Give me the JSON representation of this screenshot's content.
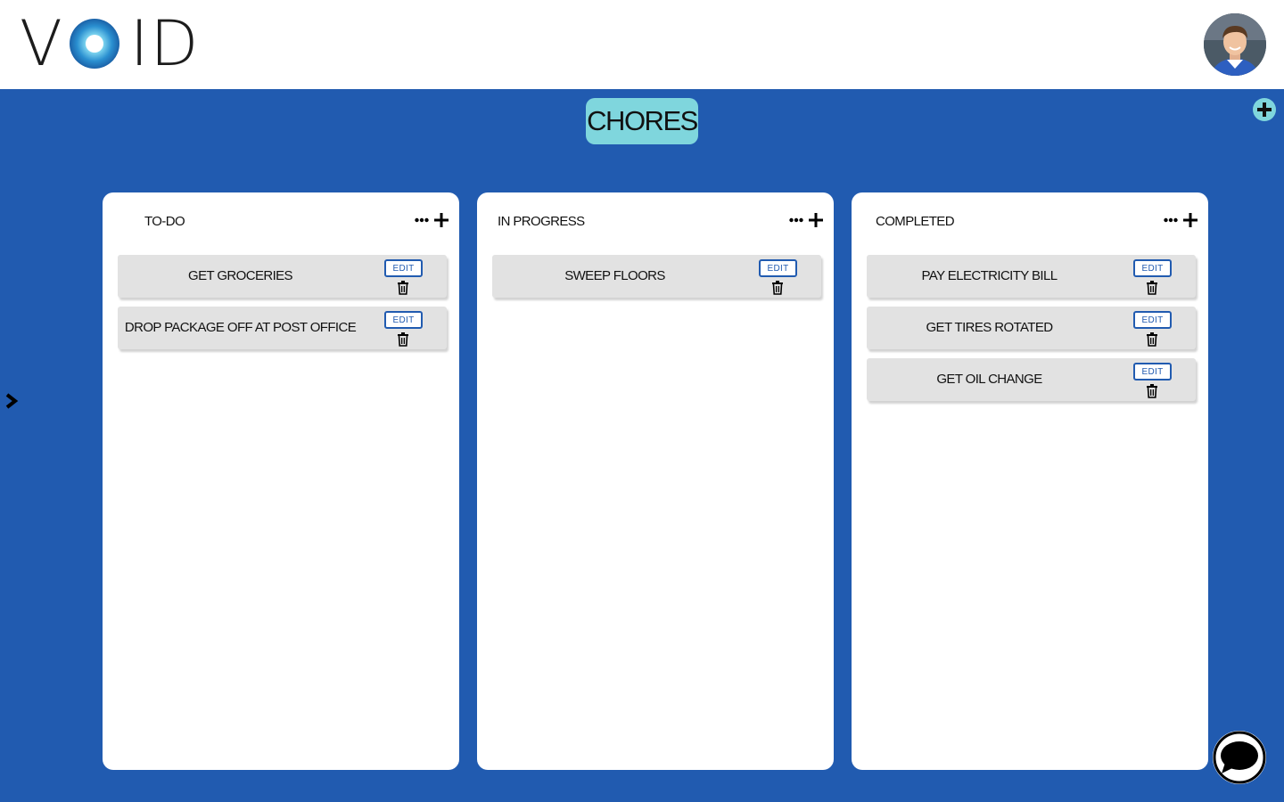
{
  "header": {
    "logo": {
      "letters": [
        "V",
        "I",
        "D"
      ],
      "o_icon": "void-ring-icon"
    },
    "avatar": {
      "icon": "user-avatar"
    }
  },
  "board": {
    "title": "CHORES",
    "add_board_icon": "plus-circle-icon",
    "sidebar_toggle_icon": "chevron-right-icon"
  },
  "columns": [
    {
      "title": "TO-DO",
      "cards": [
        {
          "text": "GET GROCERIES",
          "edit_label": "EDIT"
        },
        {
          "text": "DROP PACKAGE OFF AT POST OFFICE",
          "edit_label": "EDIT"
        }
      ]
    },
    {
      "title": "IN PROGRESS",
      "cards": [
        {
          "text": "SWEEP FLOORS",
          "edit_label": "EDIT"
        }
      ]
    },
    {
      "title": "COMPLETED",
      "cards": [
        {
          "text": "PAY ELECTRICITY BILL",
          "edit_label": "EDIT"
        },
        {
          "text": "GET TIRES ROTATED",
          "edit_label": "EDIT"
        },
        {
          "text": "GET OIL CHANGE",
          "edit_label": "EDIT"
        }
      ]
    }
  ],
  "chat": {
    "icon": "chat-bubble-icon"
  },
  "colors": {
    "background": "#215bb0",
    "accent": "#7fd6dd",
    "card": "#e2e2e2",
    "edit_border": "#215bb0"
  }
}
